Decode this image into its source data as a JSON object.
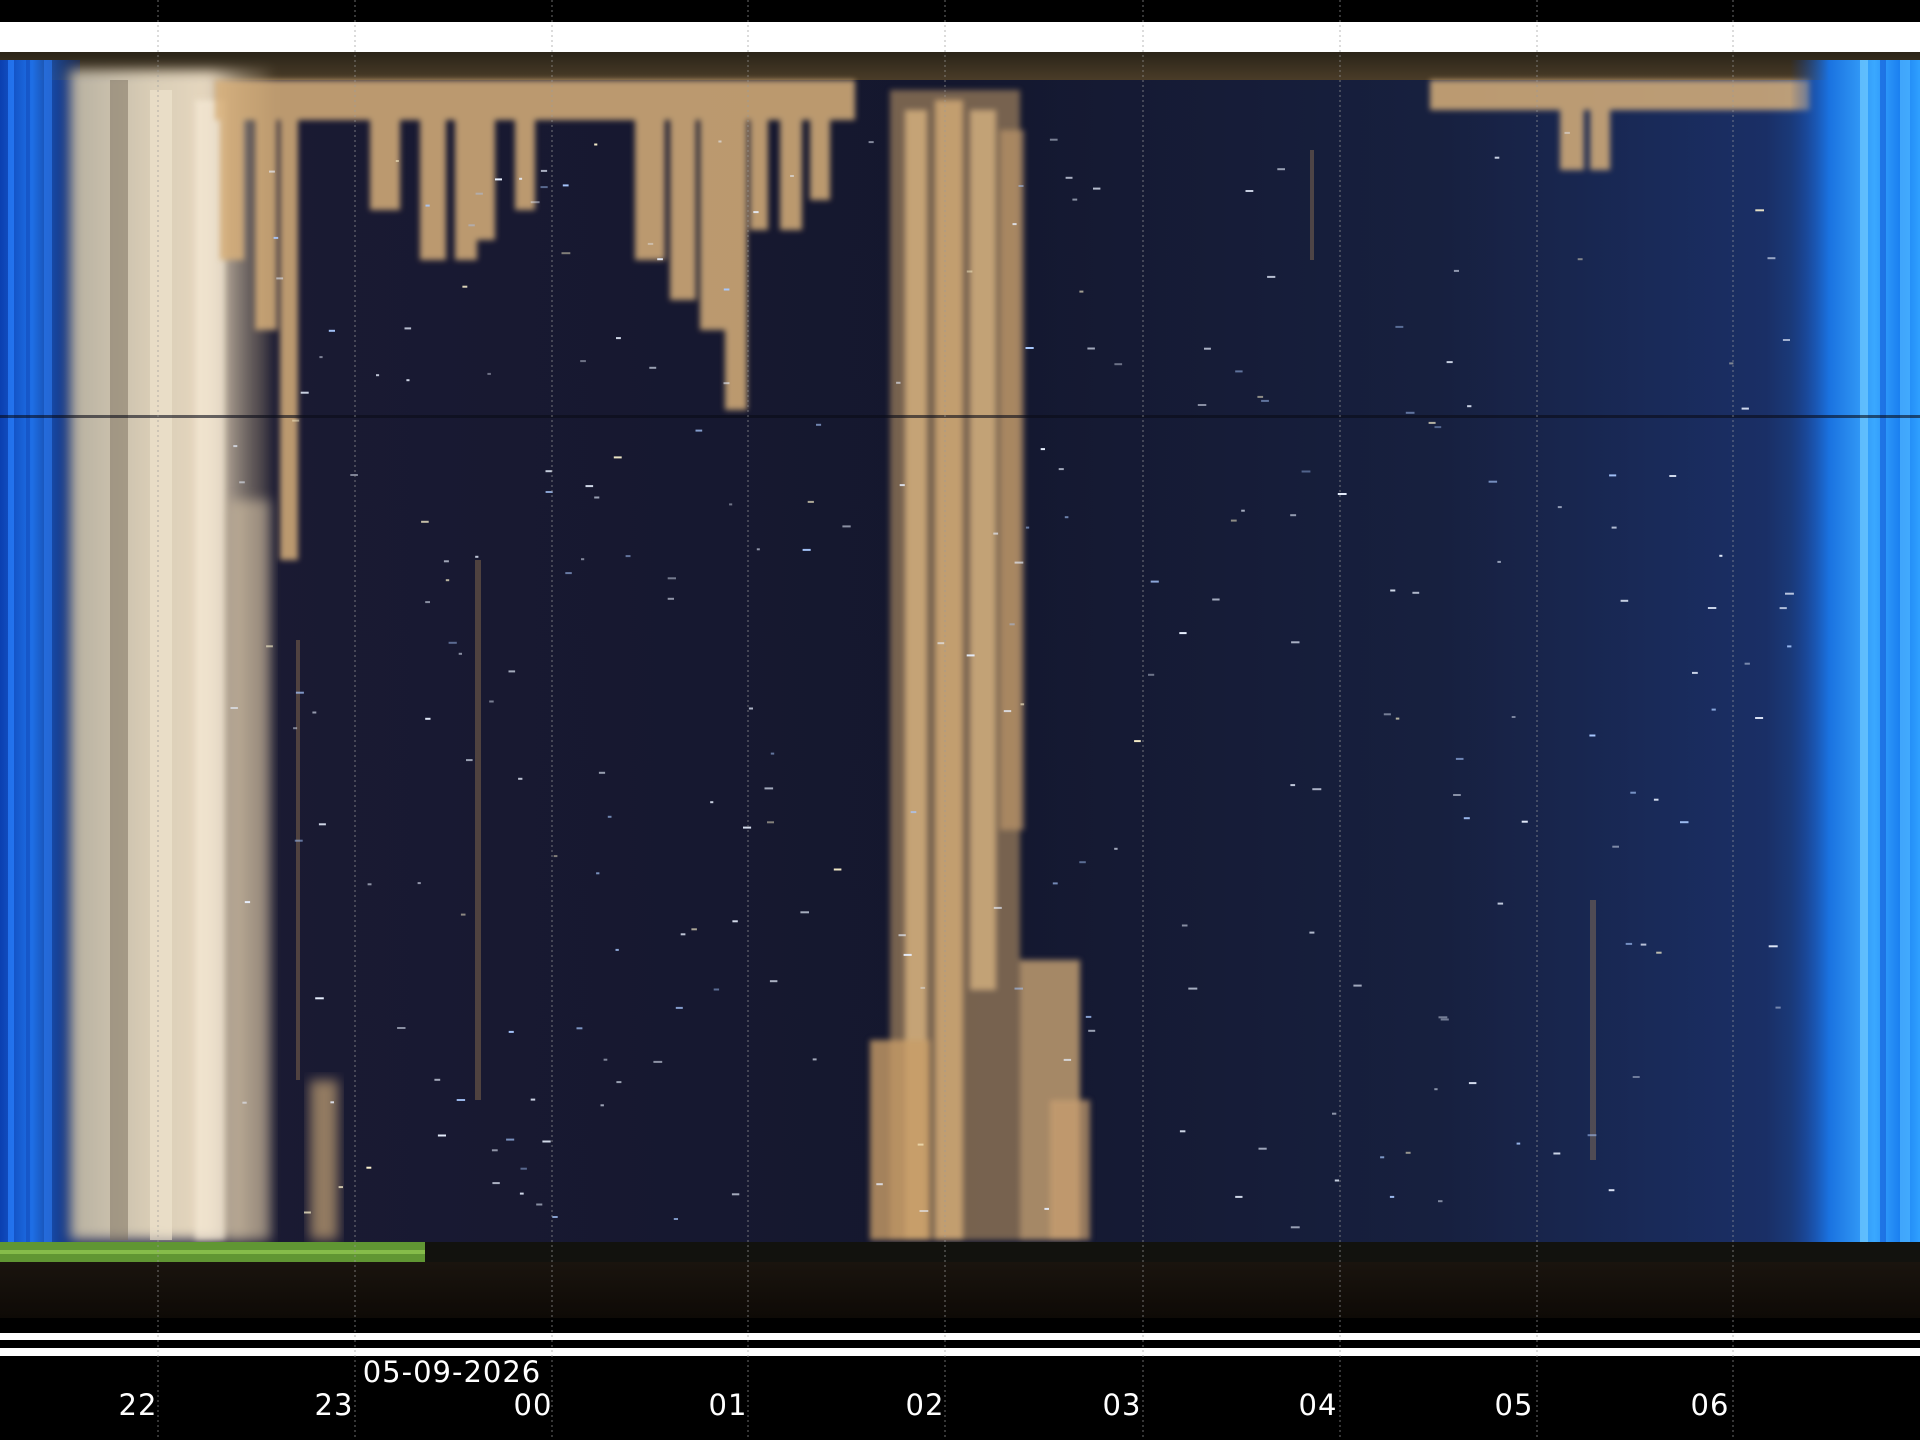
{
  "keogram": {
    "date": "05-09-2026",
    "hours": [
      "22",
      "23",
      "00",
      "01",
      "02",
      "03",
      "04",
      "05",
      "06"
    ],
    "colors": {
      "sky": "#151a33",
      "dawn_blue": "#1a7fe8",
      "glow": "#d8b07a",
      "moon": "#e8e0d0",
      "green_strip": "#6fae3a",
      "frame_white": "#ffffff",
      "background": "#000000"
    }
  }
}
